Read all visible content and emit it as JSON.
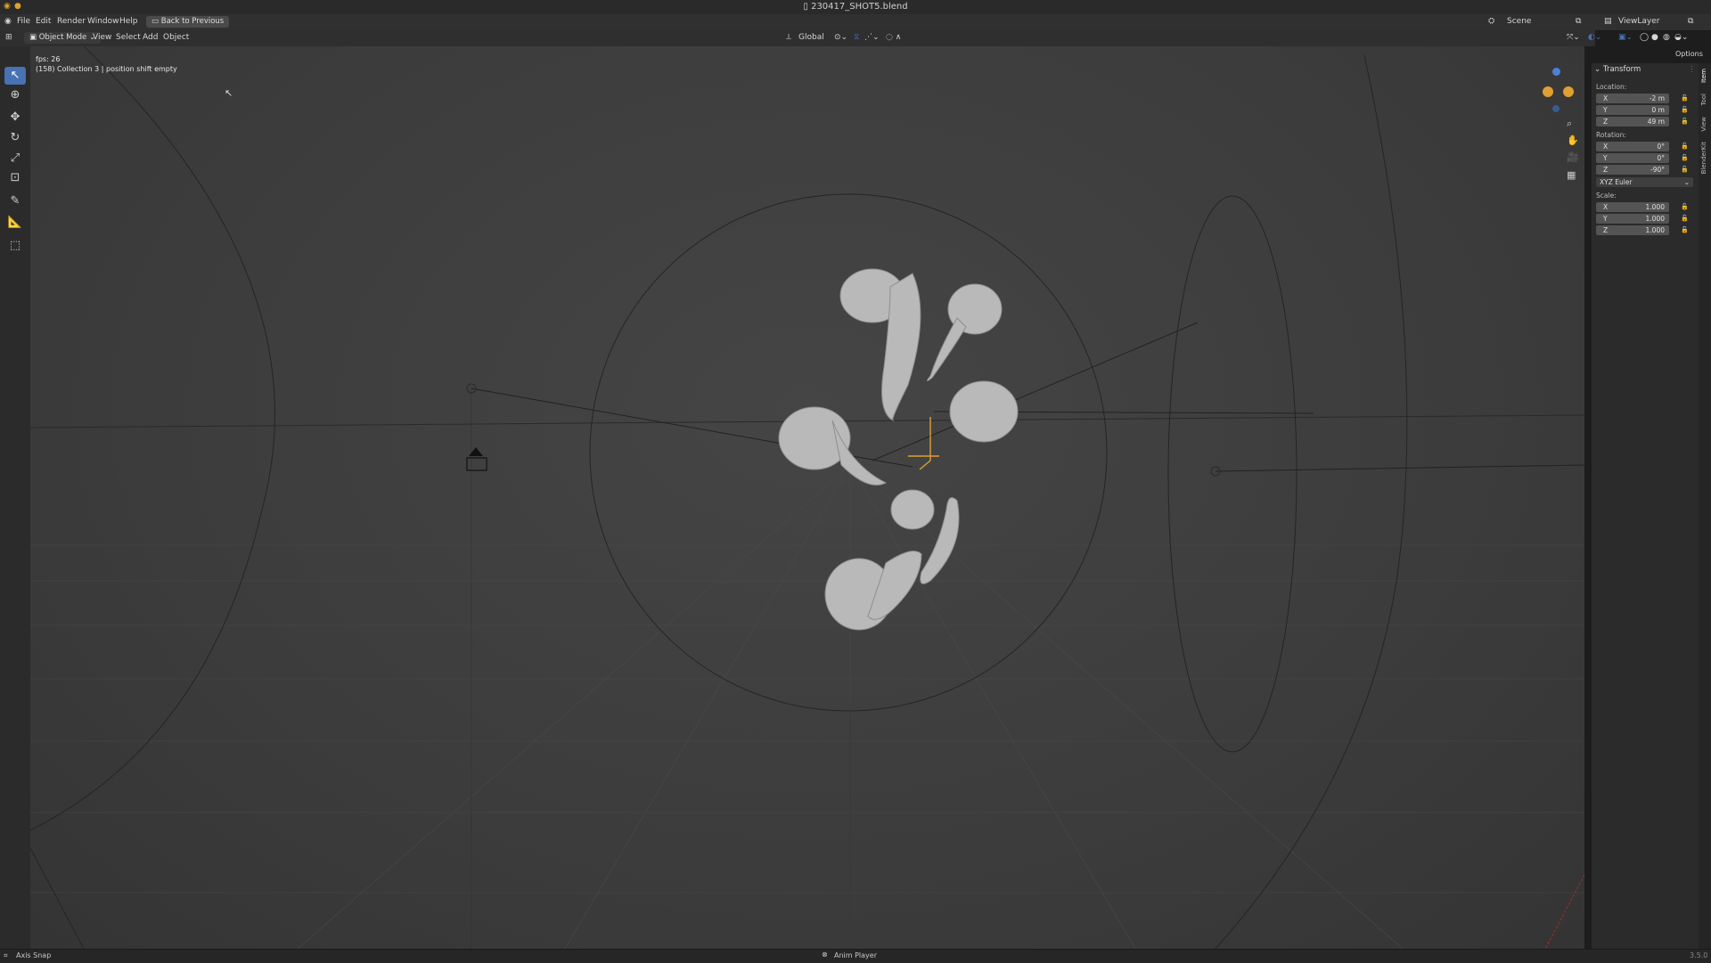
{
  "window": {
    "title": "230417_SHOT5.blend"
  },
  "menubar": {
    "file": "File",
    "edit": "Edit",
    "render": "Render",
    "window": "Window",
    "help": "Help",
    "back_button": "Back to Previous",
    "scene_label": "Scene",
    "viewlayer_label": "ViewLayer"
  },
  "viewport_header": {
    "mode": "Object Mode",
    "view": "View",
    "select": "Select",
    "add": "Add",
    "object": "Object",
    "orientation": "Global",
    "options": "Options"
  },
  "overlay": {
    "fps": "fps: 26",
    "info": "(158) Collection 3 | position shift empty"
  },
  "transform": {
    "header": "Transform",
    "location_label": "Location:",
    "location": [
      {
        "axis": "X",
        "value": "-2 m"
      },
      {
        "axis": "Y",
        "value": "0 m"
      },
      {
        "axis": "Z",
        "value": "49 m"
      }
    ],
    "rotation_label": "Rotation:",
    "rotation": [
      {
        "axis": "X",
        "value": "0°"
      },
      {
        "axis": "Y",
        "value": "0°"
      },
      {
        "axis": "Z",
        "value": "-90°"
      }
    ],
    "rotation_mode": "XYZ Euler",
    "scale_label": "Scale:",
    "scale": [
      {
        "axis": "X",
        "value": "1.000"
      },
      {
        "axis": "Y",
        "value": "1.000"
      },
      {
        "axis": "Z",
        "value": "1.000"
      }
    ]
  },
  "sidebar_tabs": [
    "Item",
    "Tool",
    "View",
    "BlenderKit"
  ],
  "statusbar": {
    "left": "Axis Snap",
    "center": "Anim Player",
    "version": "3.5.0"
  },
  "colors": {
    "accent": "#4772b3",
    "selected": "#e0a030"
  }
}
